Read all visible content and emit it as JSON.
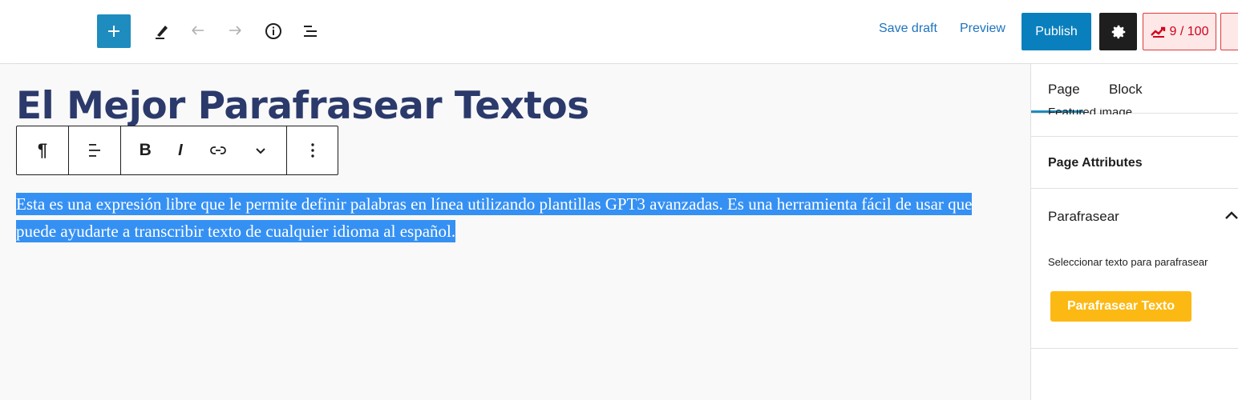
{
  "toolbar": {
    "save_draft": "Save draft",
    "preview": "Preview",
    "publish": "Publish",
    "score": "9 / 100",
    "icons": [
      "plus-icon",
      "pencil-icon",
      "undo-icon",
      "redo-icon",
      "info-icon",
      "list-view-icon",
      "gear-icon",
      "seo-score-icon"
    ]
  },
  "editor": {
    "title": "El Mejor Parafrasear Textos",
    "block_toolbar": {
      "paragraph_symbol": "¶",
      "bold": "B",
      "italic": "I"
    },
    "paragraph": "Esta es una expresión libre que le permite definir palabras en línea utilizando plantillas GPT3 avanzadas. Es una herramienta fácil de usar que puede ayudarte a transcribir texto de cualquier idioma al español."
  },
  "sidebar": {
    "tabs": [
      "Page",
      "Block"
    ],
    "cut_panel_label": "Featured image",
    "page_attributes": "Page Attributes",
    "parafrasear": {
      "title": "Parafrasear",
      "label": "Seleccionar texto para parafrasear",
      "button": "Parafrasear Texto"
    }
  },
  "colors": {
    "accent": "#1e8cbe",
    "publish": "#0a7fbd",
    "title": "#2b3a6b",
    "selection": "#3590f3",
    "score_bg": "#fde7e7",
    "score_text": "#d0021b",
    "parafrasear_btn": "#fdb913"
  }
}
